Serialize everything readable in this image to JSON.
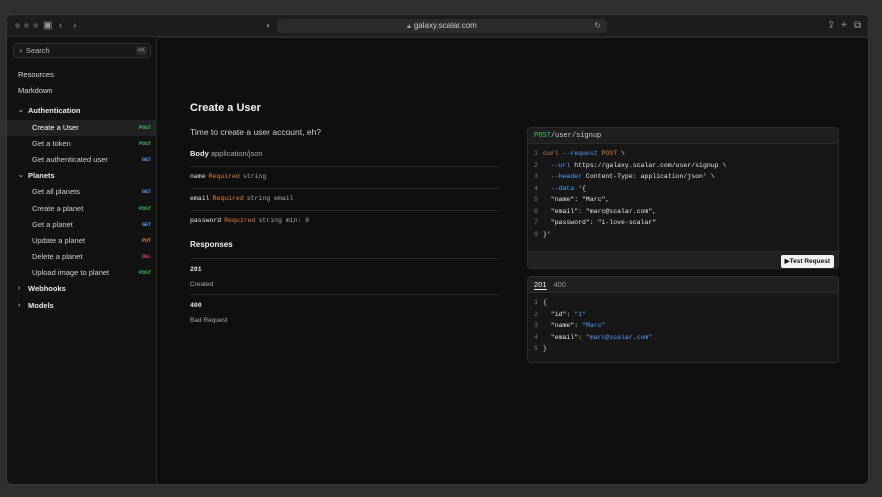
{
  "browser": {
    "url": "galaxy.scalar.com"
  },
  "sidebar": {
    "search_placeholder": "Search",
    "search_shortcut": "⌘K",
    "items": [
      {
        "label": "Resources",
        "kind": "top"
      },
      {
        "label": "Markdown",
        "kind": "top"
      },
      {
        "label": "Authentication",
        "kind": "group",
        "expanded": true
      },
      {
        "label": "Create a User",
        "kind": "sub",
        "method": "POST",
        "active": true
      },
      {
        "label": "Get a token",
        "kind": "sub",
        "method": "POST"
      },
      {
        "label": "Get authenticated user",
        "kind": "sub",
        "method": "GET"
      },
      {
        "label": "Planets",
        "kind": "group",
        "expanded": true
      },
      {
        "label": "Get all planets",
        "kind": "sub",
        "method": "GET"
      },
      {
        "label": "Create a planet",
        "kind": "sub",
        "method": "POST"
      },
      {
        "label": "Get a planet",
        "kind": "sub",
        "method": "GET"
      },
      {
        "label": "Update a planet",
        "kind": "sub",
        "method": "PUT"
      },
      {
        "label": "Delete a planet",
        "kind": "sub",
        "method": "DEL"
      },
      {
        "label": "Upload image to planet",
        "kind": "sub",
        "method": "POST"
      },
      {
        "label": "Webhooks",
        "kind": "group",
        "expanded": false
      },
      {
        "label": "Models",
        "kind": "group",
        "expanded": false
      }
    ]
  },
  "colors": {
    "POST": "#3bc25a",
    "GET": "#4fa3ff",
    "PUT": "#e0813a",
    "DEL": "#e5484d"
  },
  "main": {
    "title": "Create a User",
    "description": "Time to create a user account, eh?",
    "body_label": "Body",
    "body_type": "application/json",
    "params": [
      {
        "name": "name",
        "required": "Required",
        "type": "string"
      },
      {
        "name": "email",
        "required": "Required",
        "type": "string email"
      },
      {
        "name": "password",
        "required": "Required",
        "type": "string min: 8"
      }
    ],
    "responses_title": "Responses",
    "responses": [
      {
        "code": "201",
        "text": "Created"
      },
      {
        "code": "400",
        "text": "Bad Request"
      }
    ]
  },
  "request_card": {
    "method": "POST",
    "path": "/user/signup",
    "lines": [
      "curl --request POST \\",
      "  --url https://galaxy.scalar.com/user/signup \\",
      "  --header Content-Type: application/json' \\",
      "  --data '{",
      "  \"name\": \"Marc\",",
      "  \"email\": \"marc@scalar.com\",",
      "  \"password\": \"i-love-scalar\"",
      "}'"
    ],
    "test_button": "Test Request"
  },
  "response_card": {
    "tabs": [
      "201",
      "400"
    ],
    "active_tab": "201",
    "lines": [
      "{",
      "  \"id\": \"1\"",
      "  \"name\": \"Marc\"",
      "  \"email\": \"marc@scalar.com\"",
      "}"
    ]
  }
}
